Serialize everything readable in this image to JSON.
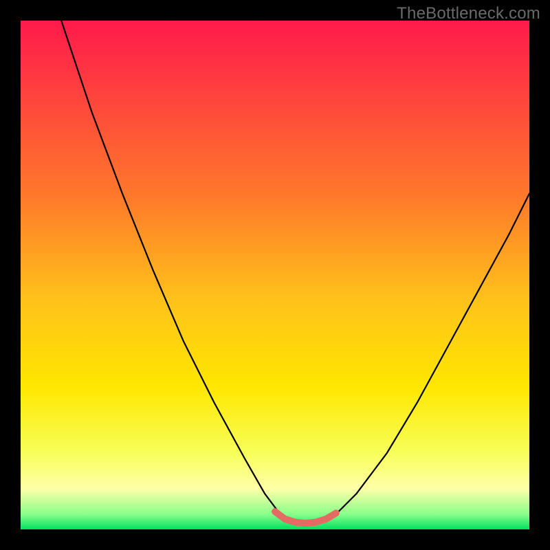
{
  "watermark": "TheBottleneck.com",
  "chart_data": {
    "type": "line",
    "title": "",
    "xlabel": "",
    "ylabel": "",
    "xlim": [
      0,
      100
    ],
    "ylim": [
      0,
      100
    ],
    "gradient_stops": [
      {
        "offset": 0,
        "color": "#ff1a4b"
      },
      {
        "offset": 35,
        "color": "#ff7a2a"
      },
      {
        "offset": 55,
        "color": "#ffc21a"
      },
      {
        "offset": 72,
        "color": "#ffe700"
      },
      {
        "offset": 85,
        "color": "#f7ff5a"
      },
      {
        "offset": 92,
        "color": "#ffffa8"
      },
      {
        "offset": 97,
        "color": "#8aff8a"
      },
      {
        "offset": 100,
        "color": "#00e060"
      }
    ],
    "series": [
      {
        "name": "left-branch",
        "stroke": "#000000",
        "points": [
          {
            "x": 8,
            "y": 100
          },
          {
            "x": 14,
            "y": 82
          },
          {
            "x": 20,
            "y": 66
          },
          {
            "x": 26,
            "y": 51
          },
          {
            "x": 32,
            "y": 37
          },
          {
            "x": 38,
            "y": 25
          },
          {
            "x": 44,
            "y": 14
          },
          {
            "x": 48,
            "y": 7
          },
          {
            "x": 51,
            "y": 3
          }
        ]
      },
      {
        "name": "right-branch",
        "stroke": "#000000",
        "points": [
          {
            "x": 62,
            "y": 3
          },
          {
            "x": 66,
            "y": 7
          },
          {
            "x": 72,
            "y": 15
          },
          {
            "x": 78,
            "y": 25
          },
          {
            "x": 84,
            "y": 36
          },
          {
            "x": 90,
            "y": 47
          },
          {
            "x": 96,
            "y": 58
          },
          {
            "x": 100,
            "y": 66
          }
        ]
      },
      {
        "name": "optimum-band",
        "stroke": "#e46a64",
        "points": [
          {
            "x": 50,
            "y": 3.5
          },
          {
            "x": 52,
            "y": 2.0
          },
          {
            "x": 54,
            "y": 1.4
          },
          {
            "x": 56,
            "y": 1.2
          },
          {
            "x": 58,
            "y": 1.4
          },
          {
            "x": 60,
            "y": 2.0
          },
          {
            "x": 62,
            "y": 3.2
          }
        ]
      }
    ]
  }
}
